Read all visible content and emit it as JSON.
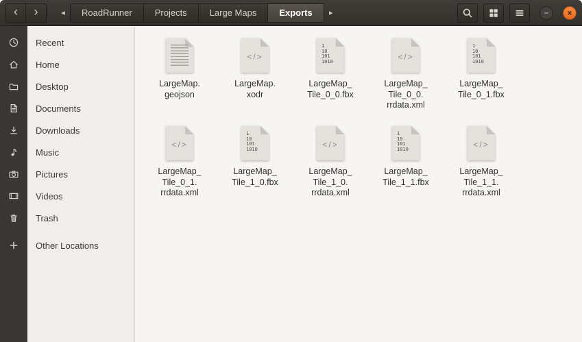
{
  "window": {
    "controls": {
      "minimize": "−",
      "close": "×"
    }
  },
  "header": {
    "back_glyph": "‹",
    "forward_glyph": "›",
    "path_left_glyph": "◂",
    "path_right_glyph": "▸",
    "breadcrumbs": [
      {
        "label": "RoadRunner",
        "active": false
      },
      {
        "label": "Projects",
        "active": false
      },
      {
        "label": "Large Maps",
        "active": false
      },
      {
        "label": "Exports",
        "active": true
      }
    ],
    "actions": [
      {
        "name": "search",
        "icon": "magnifier-icon"
      },
      {
        "name": "view-toggle",
        "icon": "grid-view-icon"
      },
      {
        "name": "menu",
        "icon": "hamburger-icon"
      }
    ]
  },
  "sidebar": {
    "items": [
      {
        "label": "Recent",
        "icon": "clock-icon"
      },
      {
        "label": "Home",
        "icon": "home-icon"
      },
      {
        "label": "Desktop",
        "icon": "folder-icon"
      },
      {
        "label": "Documents",
        "icon": "document-icon"
      },
      {
        "label": "Downloads",
        "icon": "download-icon"
      },
      {
        "label": "Music",
        "icon": "music-note-icon"
      },
      {
        "label": "Pictures",
        "icon": "camera-icon"
      },
      {
        "label": "Videos",
        "icon": "film-icon"
      },
      {
        "label": "Trash",
        "icon": "trash-icon"
      },
      {
        "label": "Other Locations",
        "icon": "plus-icon"
      }
    ]
  },
  "files": [
    {
      "name": "LargeMap.geojson",
      "icon": "text",
      "glyph": "",
      "lines": [
        "LargeMap.",
        "geojson"
      ]
    },
    {
      "name": "LargeMap.xodr",
      "icon": "code",
      "glyph": "</>",
      "lines": [
        "LargeMap.",
        "xodr"
      ]
    },
    {
      "name": "LargeMap_Tile_0_0.fbx",
      "icon": "binary",
      "glyph": "1\n10\n101\n1010",
      "lines": [
        "LargeMap_",
        "Tile_0_0.fbx"
      ]
    },
    {
      "name": "LargeMap_Tile_0_0.rrdata.xml",
      "icon": "code",
      "glyph": "</>",
      "lines": [
        "LargeMap_",
        "Tile_0_0.",
        "rrdata.xml"
      ]
    },
    {
      "name": "LargeMap_Tile_0_1.fbx",
      "icon": "binary",
      "glyph": "1\n10\n101\n1010",
      "lines": [
        "LargeMap_",
        "Tile_0_1.fbx"
      ]
    },
    {
      "name": "LargeMap_Tile_0_1.rrdata.xml",
      "icon": "code",
      "glyph": "</>",
      "lines": [
        "LargeMap_",
        "Tile_0_1.",
        "rrdata.xml"
      ]
    },
    {
      "name": "LargeMap_Tile_1_0.fbx",
      "icon": "binary",
      "glyph": "1\n10\n101\n1010",
      "lines": [
        "LargeMap_",
        "Tile_1_0.fbx"
      ]
    },
    {
      "name": "LargeMap_Tile_1_0.rrdata.xml",
      "icon": "code",
      "glyph": "</>",
      "lines": [
        "LargeMap_",
        "Tile_1_0.",
        "rrdata.xml"
      ]
    },
    {
      "name": "LargeMap_Tile_1_1.fbx",
      "icon": "binary",
      "glyph": "1\n10\n101\n1010",
      "lines": [
        "LargeMap_",
        "Tile_1_1.fbx"
      ]
    },
    {
      "name": "LargeMap_Tile_1_1.rrdata.xml",
      "icon": "code",
      "glyph": "</>",
      "lines": [
        "LargeMap_",
        "Tile_1_1.",
        "rrdata.xml"
      ]
    }
  ],
  "colors": {
    "accent_orange": "#ee7b35",
    "header_bg": "#3a3733",
    "icon_strip_bg": "#3a3633",
    "sidebar_bg": "#f0eeeb",
    "content_bg": "#f6f5f2"
  }
}
